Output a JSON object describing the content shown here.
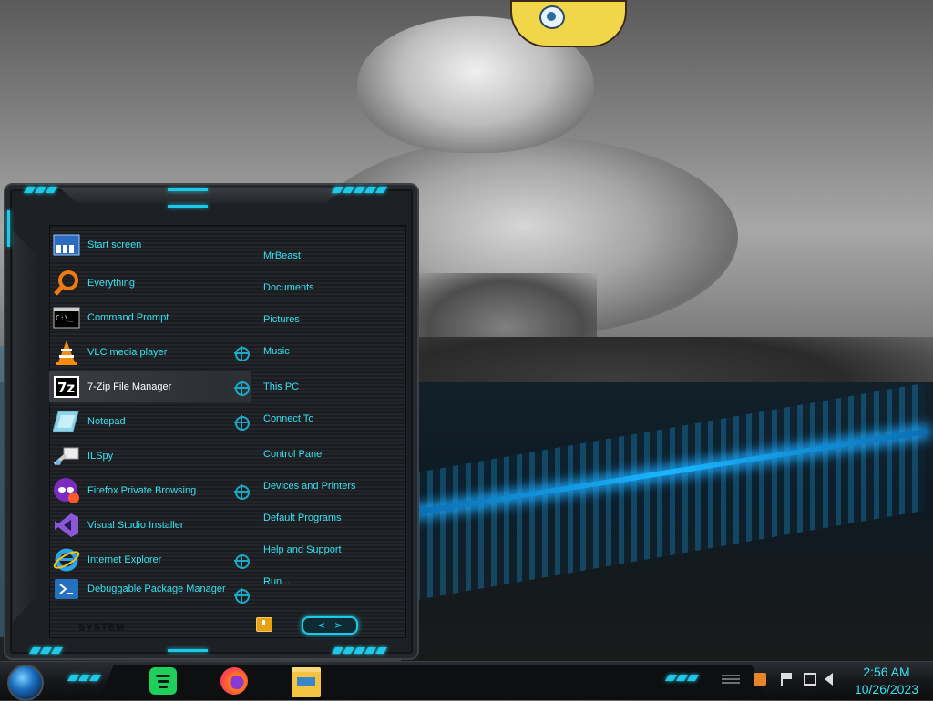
{
  "start_menu": {
    "apps": [
      {
        "label": "Start screen",
        "icon": "start-screen-icon",
        "has_submenu": false
      },
      {
        "label": "Everything",
        "icon": "magnifier-icon",
        "has_submenu": false
      },
      {
        "label": "Command Prompt",
        "icon": "command-prompt-icon",
        "has_submenu": false
      },
      {
        "label": "VLC media player",
        "icon": "vlc-cone-icon",
        "has_submenu": true
      },
      {
        "label": "7-Zip File Manager",
        "icon": "7zip-icon",
        "has_submenu": true,
        "highlighted": true
      },
      {
        "label": "Notepad",
        "icon": "notepad-icon",
        "has_submenu": true
      },
      {
        "label": "ILSpy",
        "icon": "ilspy-icon",
        "has_submenu": false
      },
      {
        "label": "Firefox Private Browsing",
        "icon": "firefox-private-icon",
        "has_submenu": true
      },
      {
        "label": "Visual Studio Installer",
        "icon": "visual-studio-icon",
        "has_submenu": false
      },
      {
        "label": "Internet Explorer",
        "icon": "internet-explorer-icon",
        "has_submenu": true
      },
      {
        "label": "Debuggable Package Manager",
        "icon": "powershell-icon",
        "has_submenu": true
      }
    ],
    "places": [
      "MrBeast",
      "Documents",
      "Pictures",
      "Music",
      "This PC",
      "Connect To",
      "Control Panel",
      "Devices and Printers",
      "Default Programs",
      "Help and Support",
      "Run..."
    ],
    "footer_label": "SYSTEM",
    "nav_arrows": {
      "left": "<",
      "right": ">"
    },
    "accent_color": "#38e0f0"
  },
  "taskbar": {
    "pinned": [
      {
        "name": "Spotify",
        "icon": "spotify-icon"
      },
      {
        "name": "Firefox",
        "icon": "firefox-icon"
      },
      {
        "name": "File Explorer",
        "icon": "file-explorer-icon"
      }
    ],
    "tray_icons": [
      "app-tray-icon",
      "flag-icon",
      "network-icon",
      "volume-icon"
    ],
    "clock": {
      "time": "2:56 AM",
      "date": "10/26/2023"
    }
  }
}
